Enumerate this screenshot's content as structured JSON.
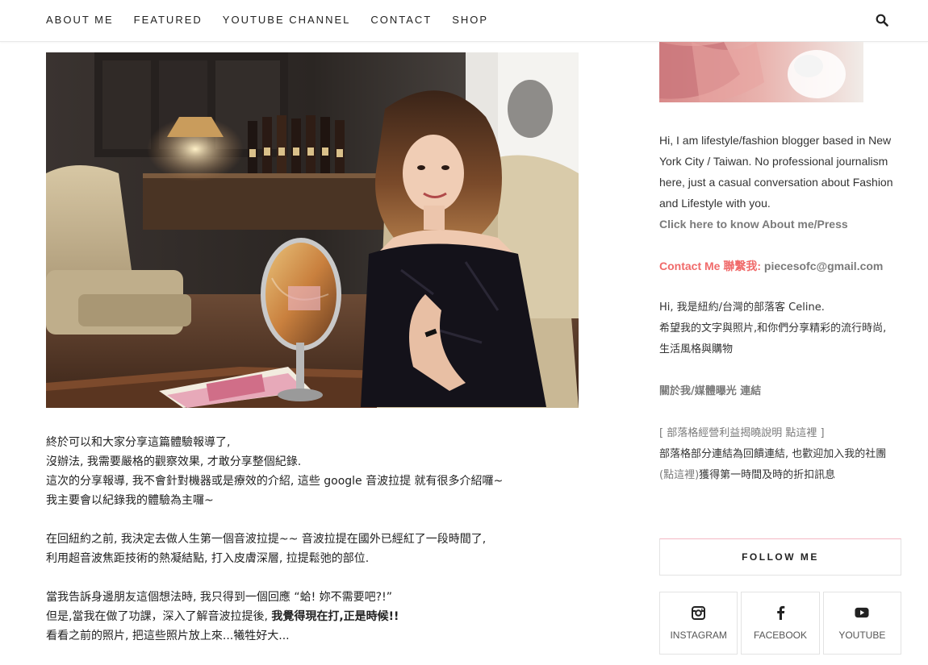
{
  "nav": {
    "items": [
      {
        "label": "ABOUT ME"
      },
      {
        "label": "FEATURED"
      },
      {
        "label": "YOUTUBE CHANNEL"
      },
      {
        "label": "CONTACT"
      },
      {
        "label": "SHOP"
      }
    ],
    "search_icon": "search-icon"
  },
  "hero": {
    "alt": "Woman seated in lounge with round mirror and magazines"
  },
  "post": {
    "p1": [
      "終於可以和大家分享這篇體驗報導了,",
      "沒辦法, 我需要嚴格的觀察效果, 才敢分享整個紀錄.",
      "這次的分享報導, 我不會針對機器或是療效的介紹, 這些 google 音波拉提 就有很多介紹囉~",
      "我主要會以紀錄我的體驗為主囉~"
    ],
    "p2": [
      "在回紐約之前, 我決定去做人生第一個音波拉提~~ 音波拉提在國外已經紅了一段時間了,",
      "利用超音波焦距技術的熱凝結點, 打入皮膚深層, 拉提鬆弛的部位."
    ],
    "p3_line1": "當我告訴身邊朋友這個想法時, 我只得到一個回應 “蛤! 妳不需要吧?!”",
    "p3_line2_plain": "但是,當我在做了功課，深入了解音波拉提後, ",
    "p3_line2_bold": "我覺得現在打,正是時候!!",
    "p3_line3": "看看之前的照片, 把這些照片放上來...犧牲好大..."
  },
  "sidebar": {
    "bio_lines": [
      "Hi, I am lifestyle/fashion blogger based in New",
      "York City / Taiwan. No professional journalism",
      "here, just a casual conversation about Fashion",
      "and Lifestyle with you."
    ],
    "about_link": "Click here to know About me/Press",
    "contact_label": "Contact Me 聯繫我:",
    "contact_email": "piecesofc@gmail.com",
    "zh_intro": [
      "Hi, 我是紐約/台灣的部落客 Celine.",
      "希望我的文字與照片,和你們分享精彩的流行時尚,",
      "生活風格與購物"
    ],
    "zh_about_link": "關於我/媒體曝光 連結",
    "disclosure_link": "[ 部落格經營利益揭曉說明 點這裡 ]",
    "affiliate_line1": "部落格部分連結為回饋連結, 也歡迎加入我的社團",
    "affiliate_link": "(點這裡)",
    "affiliate_line2_rest": "獲得第一時間及時的折扣訊息",
    "follow_title": "FOLLOW ME",
    "social": [
      {
        "label": "INSTAGRAM",
        "icon": "instagram-icon"
      },
      {
        "label": "FACEBOOK",
        "icon": "facebook-icon"
      },
      {
        "label": "YOUTUBE",
        "icon": "youtube-icon"
      }
    ]
  },
  "colors": {
    "accent_pink": "#f06a6a",
    "link_gray": "#7a7a7a",
    "follow_border_pink": "#f3b8c4"
  }
}
